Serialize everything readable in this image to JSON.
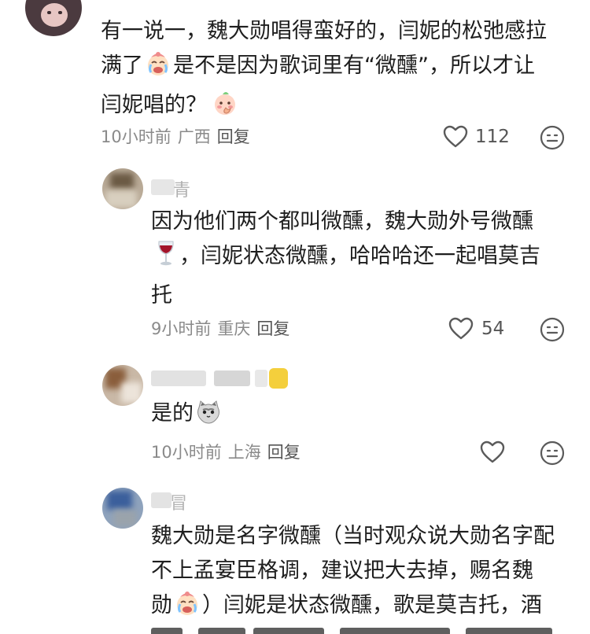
{
  "comments": [
    {
      "text_lines": [
        "有一说一，魏大勋唱得蛮好的，闫妮的松弛感拉",
        "满了",
        "是不是因为歌词里有“微醺”，所以才让",
        "闫妮唱的？"
      ],
      "time": "10小时前",
      "location": "广西",
      "reply": "回复",
      "likes": "112",
      "colors": {
        "avatar": "#4b3a3f"
      }
    },
    {
      "username_partial": "青",
      "text_lines": [
        "因为他们两个都叫微醺，魏大勋外号微醺",
        "，闫妮状态微醺，哈哈哈还一起唱莫吉",
        "托"
      ],
      "time": "9小时前",
      "location": "重庆",
      "reply": "回复",
      "likes": "54"
    },
    {
      "text_lines": [
        "是的"
      ],
      "time": "10小时前",
      "location": "上海",
      "reply": "回复"
    },
    {
      "username_partial": "冒",
      "text_lines": [
        "魏大勋是名字微醺（当时观众说大勋名字配",
        "不上孟宴臣格调，建议把大去掉，赐名魏",
        "勋",
        "）闫妮是状态微醺，歌是莫吉托，酒"
      ]
    }
  ],
  "icons": {
    "like": "heart-outline-icon",
    "options": "smiley-menu-icon",
    "emoji_cry": "crying-laugh-emoji",
    "emoji_shy": "shy-peach-emoji",
    "emoji_wine": "wine-glass-emoji",
    "emoji_cat": "cat-emoji"
  },
  "colors": {
    "text": "#1e1e1e",
    "meta": "#8a8a8a",
    "reply": "#555555",
    "icon_gray": "#6b6b6b"
  }
}
